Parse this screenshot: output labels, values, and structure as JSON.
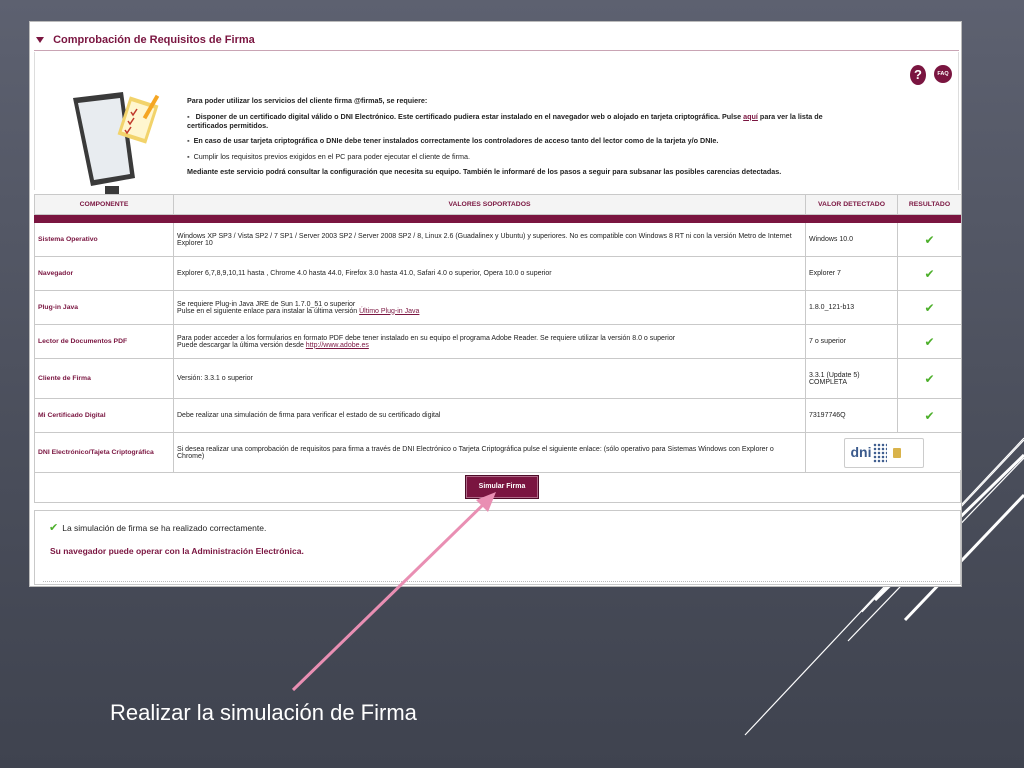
{
  "section_title": "Comprobación de Requisitos de Firma",
  "intro": {
    "lead": "Para poder utilizar los servicios del cliente firma @firma5, se requiere:",
    "bullet1_a": "Disponer de un certificado digital válido o DNI Electrónico. Este certificado pudiera estar instalado en el navegador web o alojado en tarjeta criptográfica. Pulse ",
    "bullet1_link": "aquí",
    "bullet1_b": " para ver la lista de certificados permitidos.",
    "bullet2": "En caso de usar tarjeta criptográfica o DNIe debe tener instalados correctamente los controladores de acceso tanto del lector como de la tarjeta y/o DNIe.",
    "bullet3": "Cumplir los requisitos previos exigidos en el PC para poder ejecutar el cliente de firma.",
    "closing": "Mediante este servicio podrá consultar la configuración que necesita su equipo. También le informaré de los pasos a seguir para subsanar las posibles carencias detectadas."
  },
  "icons": {
    "help": "?",
    "faq": "FAQ"
  },
  "table": {
    "headers": {
      "component": "COMPONENTE",
      "supported": "VALORES SOPORTADOS",
      "detected": "VALOR DETECTADO",
      "result": "RESULTADO"
    },
    "rows": [
      {
        "component": "Sistema Operativo",
        "supported": "Windows XP SP3 / Vista SP2 / 7 SP1 / Server 2003 SP2 / Server 2008 SP2 / 8, Linux 2.6 (Guadalinex y Ubuntu) y superiores. No es compatible con Windows 8 RT ni con la versión Metro de Internet Explorer 10",
        "detected": "Windows 10.0",
        "result": "✔"
      },
      {
        "component": "Navegador",
        "supported": "Explorer 6,7,8,9,10,11 hasta , Chrome 4.0 hasta 44.0, Firefox 3.0 hasta 41.0, Safari 4.0 o superior, Opera 10.0 o superior",
        "detected": "Explorer 7",
        "result": "✔"
      },
      {
        "component": "Plug-in Java",
        "supported_l1": "Se requiere Plug-in Java JRE de Sun 1.7.0_51 o superior",
        "supported_l2a": "Pulse en el siguiente enlace para instalar la última versión ",
        "supported_link": "Último Plug-in Java",
        "detected": "1.8.0_121-b13",
        "result": "✔"
      },
      {
        "component": "Lector de Documentos PDF",
        "supported_l1": "Para poder acceder a los formularios en formato PDF debe tener instalado en su equipo el programa Adobe Reader. Se requiere utilizar la versión 8.0 o superior",
        "supported_l2a": "Puede descargar la última versión desde ",
        "supported_link": "http://www.adobe.es",
        "detected": "7 o superior",
        "result": "✔"
      },
      {
        "component": "Cliente de Firma",
        "supported": "Versión: 3.3.1 o superior",
        "detected_l1": "3.3.1 (Update 5)",
        "detected_l2": "COMPLETA",
        "result": "✔"
      },
      {
        "component": "Mi Certificado Digital",
        "supported": "Debe realizar una simulación de firma para verificar el estado de su certificado digital",
        "detected": "73197746Q",
        "result": "✔"
      },
      {
        "component": "DNI Electrónico/Tajeta Criptográfica",
        "supported": "Si desea realizar una comprobación de requisitos para firma a través de DNI Electrónico o Tarjeta Criptográfica pulse el siguiente enlace: (sólo operativo para Sistemas Windows con Explorer o Chrome)",
        "detected_logo": "dni"
      }
    ]
  },
  "button": {
    "label": "Simular Firma"
  },
  "result": {
    "ok_message": "La simulación de firma se ha realizado correctamente.",
    "info_message": "Su navegador puede operar con la Administración Electrónica."
  },
  "caption": "Realizar la simulación de Firma",
  "colors": {
    "brand": "#7a1540",
    "check": "#4caf2a",
    "arrow": "#e98fb3",
    "background": "#4b4f5c"
  }
}
